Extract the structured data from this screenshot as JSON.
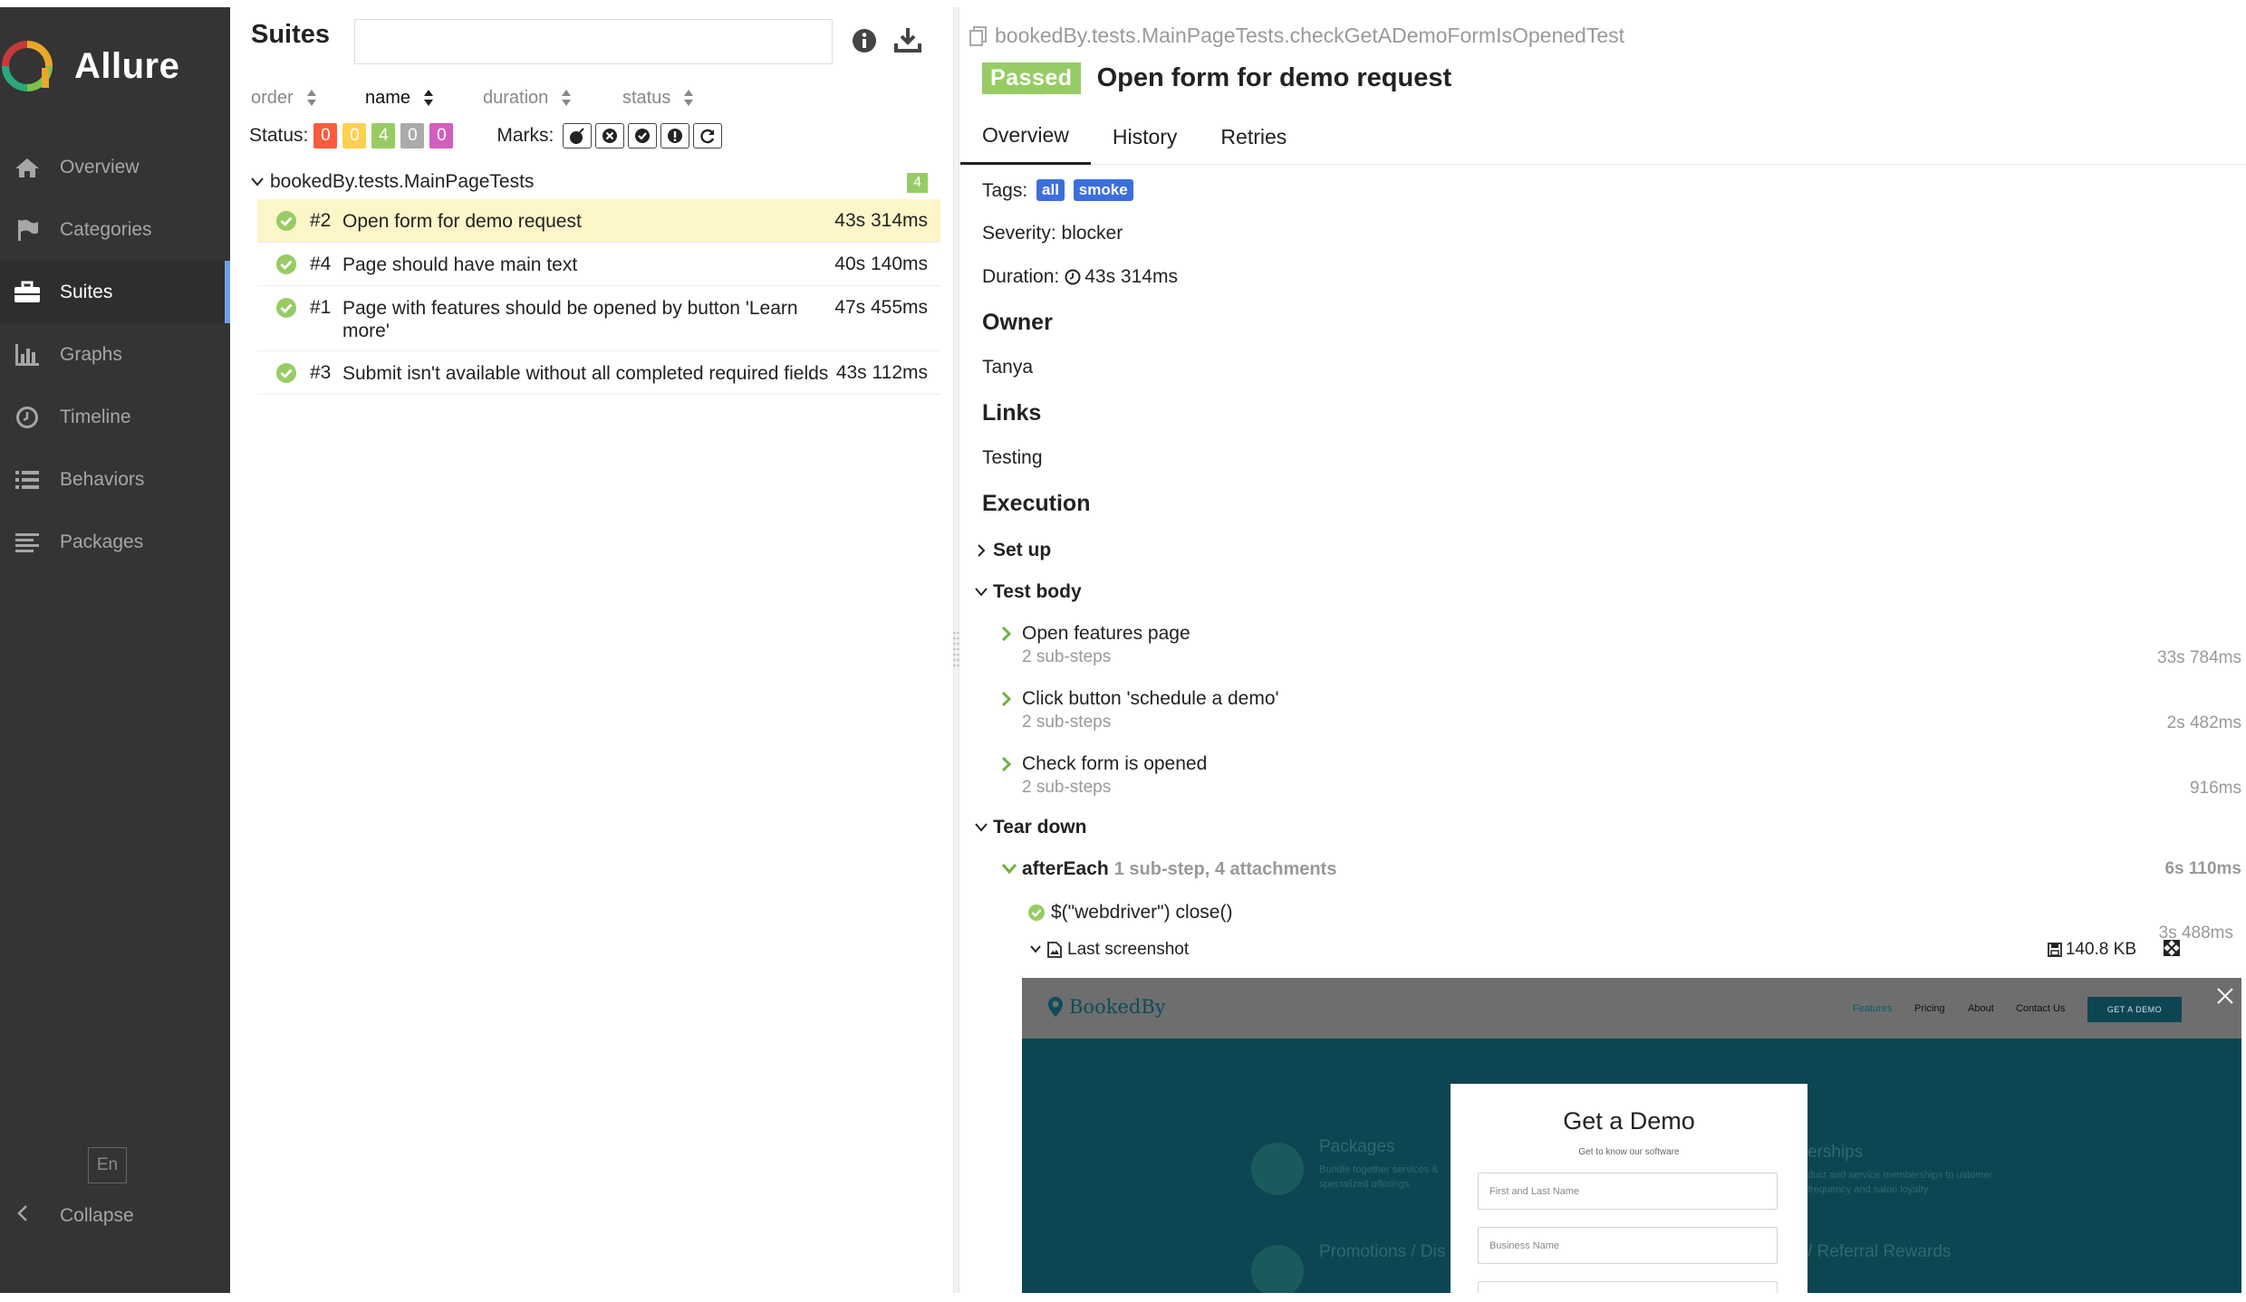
{
  "sidebar": {
    "brand": "Allure",
    "items": [
      {
        "label": "Overview",
        "icon": "home-icon"
      },
      {
        "label": "Categories",
        "icon": "flag-icon"
      },
      {
        "label": "Suites",
        "icon": "briefcase-icon",
        "active": true
      },
      {
        "label": "Graphs",
        "icon": "bar-chart-icon"
      },
      {
        "label": "Timeline",
        "icon": "clock-icon"
      },
      {
        "label": "Behaviors",
        "icon": "list-icon"
      },
      {
        "label": "Packages",
        "icon": "align-left-icon"
      }
    ],
    "language": "En",
    "collapse_label": "Collapse"
  },
  "suites_pane": {
    "title": "Suites",
    "search": {
      "value": "",
      "placeholder": ""
    },
    "sorters": [
      {
        "label": "order",
        "active": false
      },
      {
        "label": "name",
        "active": true
      },
      {
        "label": "duration",
        "active": false
      },
      {
        "label": "status",
        "active": false
      }
    ],
    "status_label": "Status:",
    "status_badges": [
      {
        "count": "0",
        "color": "#fd5a3e",
        "name": "failed"
      },
      {
        "count": "0",
        "color": "#ffd050",
        "name": "broken"
      },
      {
        "count": "4",
        "color": "#97cc64",
        "name": "passed"
      },
      {
        "count": "0",
        "color": "#aaaaaa",
        "name": "skipped"
      },
      {
        "count": "0",
        "color": "#d35ebe",
        "name": "unknown"
      }
    ],
    "marks_label": "Marks:",
    "marks": [
      "flaky-bomb-icon",
      "new-failed-icon",
      "new-passed-icon",
      "new-broken-icon",
      "retries-icon"
    ],
    "suite": {
      "name": "bookedBy.tests.MainPageTests",
      "count": "4",
      "tests": [
        {
          "num": "#2",
          "name": "Open form for demo request",
          "duration": "43s 314ms",
          "selected": true
        },
        {
          "num": "#4",
          "name": "Page should have main text",
          "duration": "40s 140ms"
        },
        {
          "num": "#1",
          "name": "Page with features should be opened by button 'Learn more'",
          "duration": "47s 455ms"
        },
        {
          "num": "#3",
          "name": "Submit isn't available without all completed required fields",
          "duration": "43s 112ms"
        }
      ]
    }
  },
  "details": {
    "breadcrumb": "bookedBy.tests.MainPageTests.checkGetADemoFormIsOpenedTest",
    "status": "Passed",
    "title": "Open form for demo request",
    "tabs": [
      "Overview",
      "History",
      "Retries"
    ],
    "tags_label": "Tags:",
    "tags": [
      "all",
      "smoke"
    ],
    "severity": "Severity: blocker",
    "duration_label": "Duration:",
    "duration": "43s 314ms",
    "owner_heading": "Owner",
    "owner": "Tanya",
    "links_heading": "Links",
    "link": "Testing",
    "execution_heading": "Execution",
    "setup_label": "Set up",
    "test_body_label": "Test body",
    "steps": [
      {
        "name": "Open features page",
        "sub": "2 sub-steps",
        "duration": "33s 784ms"
      },
      {
        "name": "Click button 'schedule a demo'",
        "sub": "2 sub-steps",
        "duration": "2s 482ms"
      },
      {
        "name": "Check form is opened",
        "sub": "2 sub-steps",
        "duration": "916ms"
      }
    ],
    "teardown_label": "Tear down",
    "after_each": {
      "name": "afterEach",
      "meta": "1 sub-step, 4 attachments",
      "duration": "6s 110ms"
    },
    "webdriver_step": "$(\"webdriver\") close()",
    "webdriver_duration": "3s 488ms",
    "attachment": {
      "name": "Last screenshot",
      "size": "140.8 KB"
    }
  },
  "screenshot": {
    "logo": "BookedBy",
    "nav_links": [
      "Features",
      "Pricing",
      "About",
      "Contact Us"
    ],
    "cta": "GET A DEMO",
    "modal_title": "Get a Demo",
    "modal_subtitle": "Get to know our software",
    "fields": [
      "First and Last Name",
      "Business Name"
    ],
    "bg_features": [
      {
        "title": "Packages",
        "desc": "Bundle together services & specialized offerings."
      },
      {
        "title": "erships",
        "desc": "duct and service memberships to ustomer frequency and salon loyalty."
      },
      {
        "title": "Promotions / Dis",
        "desc": ""
      },
      {
        "title": "/ Referral Rewards",
        "desc": ""
      }
    ]
  },
  "colors": {
    "sidebar_bg": "#343434",
    "accent_blue": "#6fa0e3",
    "passed_green": "#97cc64",
    "selected_row": "#fdf6c8",
    "tag_blue": "#3c6fdb",
    "shot_teal": "#0d4652"
  }
}
